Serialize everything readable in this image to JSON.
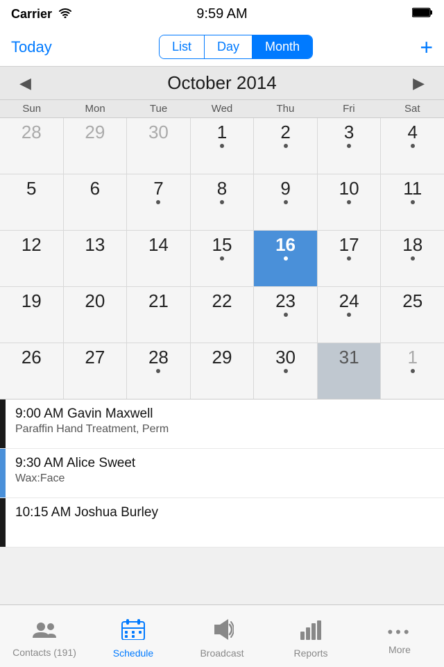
{
  "status": {
    "carrier": "Carrier",
    "time": "9:59 AM",
    "battery": "100"
  },
  "nav": {
    "today_label": "Today",
    "list_label": "List",
    "day_label": "Day",
    "month_label": "Month",
    "add_label": "+"
  },
  "calendar": {
    "title": "October 2014",
    "prev_label": "◀",
    "next_label": "▶",
    "day_headers": [
      "Sun",
      "Mon",
      "Tue",
      "Wed",
      "Thu",
      "Fri",
      "Sat"
    ],
    "weeks": [
      [
        {
          "date": "28",
          "other": true,
          "dot": false
        },
        {
          "date": "29",
          "other": true,
          "dot": false
        },
        {
          "date": "30",
          "other": true,
          "dot": false
        },
        {
          "date": "1",
          "other": false,
          "dot": true
        },
        {
          "date": "2",
          "other": false,
          "dot": true
        },
        {
          "date": "3",
          "other": false,
          "dot": true
        },
        {
          "date": "4",
          "other": false,
          "dot": true
        }
      ],
      [
        {
          "date": "5",
          "other": false,
          "dot": false
        },
        {
          "date": "6",
          "other": false,
          "dot": false
        },
        {
          "date": "7",
          "other": false,
          "dot": true
        },
        {
          "date": "8",
          "other": false,
          "dot": true
        },
        {
          "date": "9",
          "other": false,
          "dot": true
        },
        {
          "date": "10",
          "other": false,
          "dot": true
        },
        {
          "date": "11",
          "other": false,
          "dot": true
        }
      ],
      [
        {
          "date": "12",
          "other": false,
          "dot": false
        },
        {
          "date": "13",
          "other": false,
          "dot": false
        },
        {
          "date": "14",
          "other": false,
          "dot": false
        },
        {
          "date": "15",
          "other": false,
          "dot": true
        },
        {
          "date": "16",
          "other": false,
          "dot": true,
          "today": true
        },
        {
          "date": "17",
          "other": false,
          "dot": true
        },
        {
          "date": "18",
          "other": false,
          "dot": true
        }
      ],
      [
        {
          "date": "19",
          "other": false,
          "dot": false
        },
        {
          "date": "20",
          "other": false,
          "dot": false
        },
        {
          "date": "21",
          "other": false,
          "dot": false
        },
        {
          "date": "22",
          "other": false,
          "dot": false
        },
        {
          "date": "23",
          "other": false,
          "dot": true
        },
        {
          "date": "24",
          "other": false,
          "dot": true
        },
        {
          "date": "25",
          "other": false,
          "dot": false
        }
      ],
      [
        {
          "date": "26",
          "other": false,
          "dot": false
        },
        {
          "date": "27",
          "other": false,
          "dot": false
        },
        {
          "date": "28",
          "other": false,
          "dot": true
        },
        {
          "date": "29",
          "other": false,
          "dot": false
        },
        {
          "date": "30",
          "other": false,
          "dot": true
        },
        {
          "date": "31",
          "other": false,
          "dot": false,
          "dark": true
        },
        {
          "date": "1",
          "other": true,
          "dot": true
        }
      ]
    ]
  },
  "appointments": [
    {
      "time": "9:00 AM",
      "name": "Gavin Maxwell",
      "detail": "Paraffin Hand Treatment, Perm",
      "bar_color": "#1a1a1a"
    },
    {
      "time": "9:30 AM",
      "name": "Alice Sweet",
      "detail": "Wax:Face",
      "bar_color": "#4a90d9"
    },
    {
      "time": "10:15 AM",
      "name": "Joshua Burley",
      "detail": "",
      "bar_color": "#1a1a1a",
      "partial": true
    }
  ],
  "tabs": [
    {
      "id": "contacts",
      "label": "Contacts (191)",
      "icon": "contacts",
      "active": false
    },
    {
      "id": "schedule",
      "label": "Schedule",
      "icon": "calendar",
      "active": true
    },
    {
      "id": "broadcast",
      "label": "Broadcast",
      "icon": "broadcast",
      "active": false
    },
    {
      "id": "reports",
      "label": "Reports",
      "icon": "reports",
      "active": false
    },
    {
      "id": "more",
      "label": "More",
      "icon": "more",
      "active": false
    }
  ]
}
